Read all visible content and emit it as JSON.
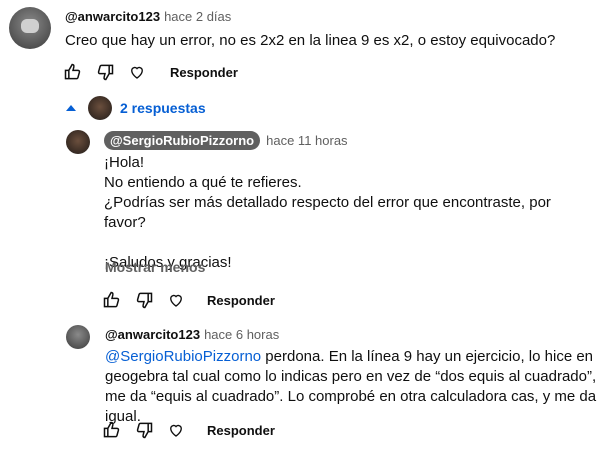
{
  "comment": {
    "author": "@anwarcito123",
    "time": "hace 2 días",
    "text": "Creo que hay un error, no es 2x2 en la linea 9 es x2, o estoy equivocado?",
    "reply_label": "Responder"
  },
  "replies_toggle": {
    "label": "2 respuestas"
  },
  "reply1": {
    "author": "@SergioRubioPizzorno",
    "time": "hace 11 horas",
    "lines": [
      "¡Hola!",
      "No entiendo a qué te refieres.",
      "¿Podrías ser más detallado respecto del error que encontraste, por favor?",
      "",
      "¡Saludos y gracias!"
    ],
    "show_less": "Mostrar menos",
    "reply_label": "Responder"
  },
  "reply2": {
    "author": "@anwarcito123",
    "time": "hace 6 horas",
    "mention": "@SergioRubioPizzorno",
    "text": " perdona. En la línea 9 hay un ejercicio, lo hice en geogebra tal cual como lo indicas pero en vez de “dos equis al cuadrado”, me da “equis al cuadrado”. Lo comprobé en otra calculadora cas, y me da igual.",
    "reply_label": "Responder"
  },
  "icons": [
    "like-icon",
    "dislike-icon",
    "heart-icon",
    "chevron-up-icon"
  ],
  "colors": {
    "link": "#065fd4",
    "muted": "#606060",
    "text": "#0f0f0f"
  }
}
